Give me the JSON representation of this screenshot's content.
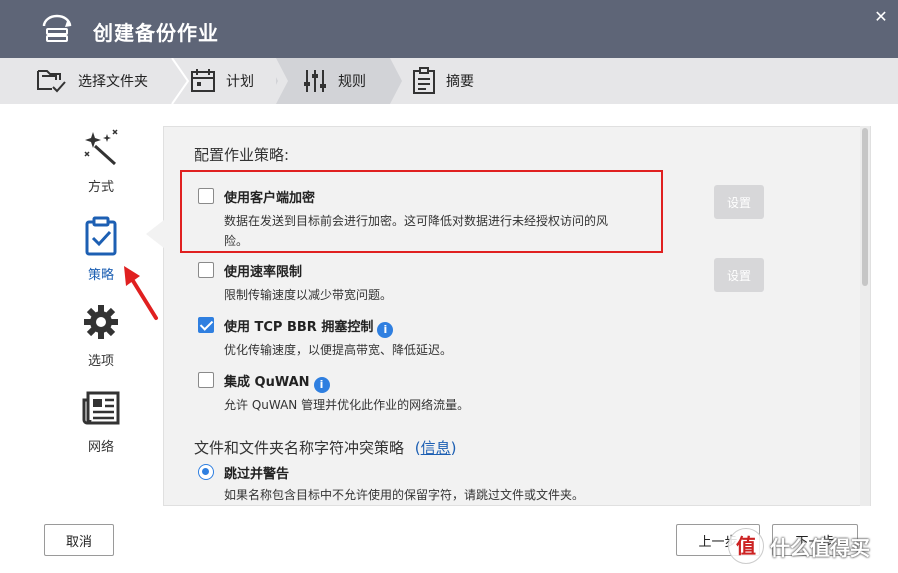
{
  "window": {
    "title": "创建备份作业",
    "close_icon": "close-icon"
  },
  "stepper": {
    "steps": [
      {
        "label": "选择文件夹",
        "icon": "folder-check-icon"
      },
      {
        "label": "计划",
        "icon": "calendar-icon"
      },
      {
        "label": "规则",
        "icon": "sliders-icon",
        "active": true
      },
      {
        "label": "摘要",
        "icon": "clipboard-list-icon"
      }
    ]
  },
  "sidebar": {
    "items": [
      {
        "label": "方式",
        "icon": "magic-wand-icon"
      },
      {
        "label": "策略",
        "icon": "clipboard-check-icon",
        "active": true
      },
      {
        "label": "选项",
        "icon": "gear-icon"
      },
      {
        "label": "网络",
        "icon": "newspaper-icon"
      }
    ]
  },
  "policy": {
    "section_title": "配置作业策略:",
    "options": [
      {
        "title": "使用客户端加密",
        "desc_line1": "数据在发送到目标前会进行加密。这可降低对数据进行未经授权访问的风",
        "desc_line2": "险。",
        "checked": false,
        "button": "设置"
      },
      {
        "title": "使用速率限制",
        "desc_line1": "限制传输速度以减少带宽问题。",
        "checked": false,
        "button": "设置"
      },
      {
        "title": "使用 TCP BBR 拥塞控制",
        "desc_line1": "优化传输速度，以便提高带宽、降低延迟。",
        "checked": true,
        "info": "i"
      },
      {
        "title": "集成 QuWAN",
        "desc_line1": "允许 QuWAN 管理并优化此作业的网络流量。",
        "checked": false,
        "info": "i"
      }
    ]
  },
  "conflict": {
    "section_title": "文件和文件夹名称字符冲突策略",
    "info_link_open": "(",
    "info_link": "信息",
    "info_link_close": ")",
    "selected_option": "跳过并警告",
    "selected_desc": "如果名称包含目标中不允许使用的保留字符，请跳过文件或文件夹。"
  },
  "footer": {
    "cancel": "取消",
    "prev": "上一步",
    "next": "下一步"
  },
  "watermark": {
    "logo": "值",
    "text": "什么值得买"
  },
  "colors": {
    "titlebar": "#5e6577",
    "accent": "#2f7fe0",
    "highlight": "#e02020"
  }
}
